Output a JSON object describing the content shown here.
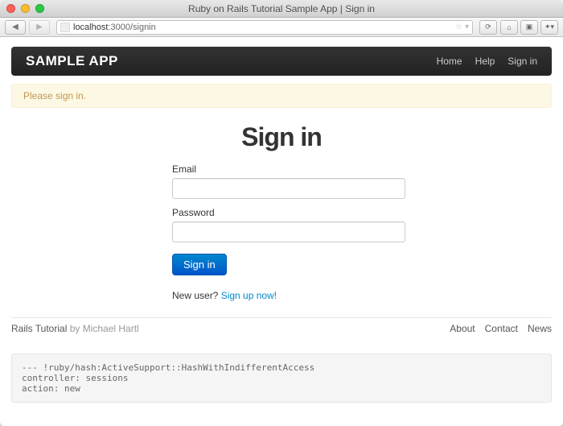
{
  "browser": {
    "window_title": "Ruby on Rails Tutorial Sample App | Sign in",
    "url_host": "localhost",
    "url_path": ":3000/signin"
  },
  "navbar": {
    "brand": "SAMPLE APP",
    "links": {
      "home": "Home",
      "help": "Help",
      "signin": "Sign in"
    }
  },
  "flash": {
    "message": "Please sign in."
  },
  "page": {
    "title": "Sign in",
    "form": {
      "email_label": "Email",
      "email_value": "",
      "password_label": "Password",
      "password_value": "",
      "submit_label": "Sign in"
    },
    "signup": {
      "prefix": "New user? ",
      "link": "Sign up now!"
    }
  },
  "footer": {
    "site": "Rails Tutorial",
    "byline": " by Michael Hartl",
    "links": {
      "about": "About",
      "contact": "Contact",
      "news": "News"
    }
  },
  "debug": {
    "dump": "--- !ruby/hash:ActiveSupport::HashWithIndifferentAccess\ncontroller: sessions\naction: new"
  }
}
